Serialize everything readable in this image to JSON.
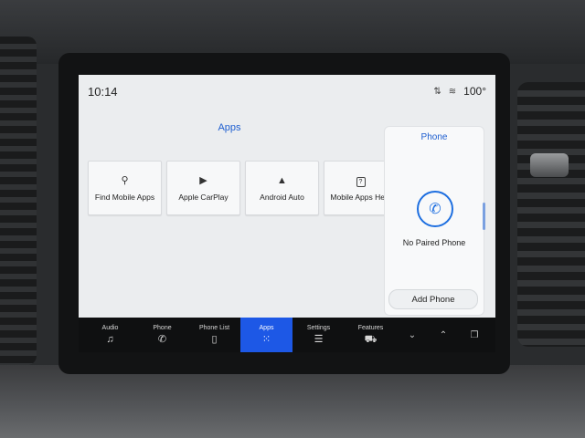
{
  "status_bar": {
    "time": "10:14",
    "temperature": "100°",
    "icons": [
      "sync-icon",
      "wifi-icon"
    ]
  },
  "apps": {
    "title": "Apps",
    "tiles": [
      {
        "label": "Find Mobile Apps",
        "icon": "search-apps-icon"
      },
      {
        "label": "Apple CarPlay",
        "icon": "carplay-icon"
      },
      {
        "label": "Android Auto",
        "icon": "android-auto-icon"
      },
      {
        "label": "Mobile Apps Help",
        "icon": "help-icon"
      }
    ]
  },
  "phone": {
    "title": "Phone",
    "status": "No Paired Phone",
    "add_button": "Add Phone",
    "icon": "phone-handset-icon"
  },
  "nav": {
    "items": [
      {
        "label": "Audio",
        "icon": "music-note-icon"
      },
      {
        "label": "Phone",
        "icon": "phone-icon"
      },
      {
        "label": "Phone List",
        "icon": "phone-list-icon"
      },
      {
        "label": "Apps",
        "icon": "apps-grid-icon",
        "active": true
      },
      {
        "label": "Settings",
        "icon": "sliders-icon"
      },
      {
        "label": "Features",
        "icon": "truck-icon"
      }
    ],
    "extra_icons": [
      "chevron-down-icon",
      "chevron-up-icon",
      "pages-icon"
    ]
  },
  "colors": {
    "accent": "#1d58e6",
    "title_blue": "#2060d0",
    "screen_bg": "#ebedef"
  }
}
